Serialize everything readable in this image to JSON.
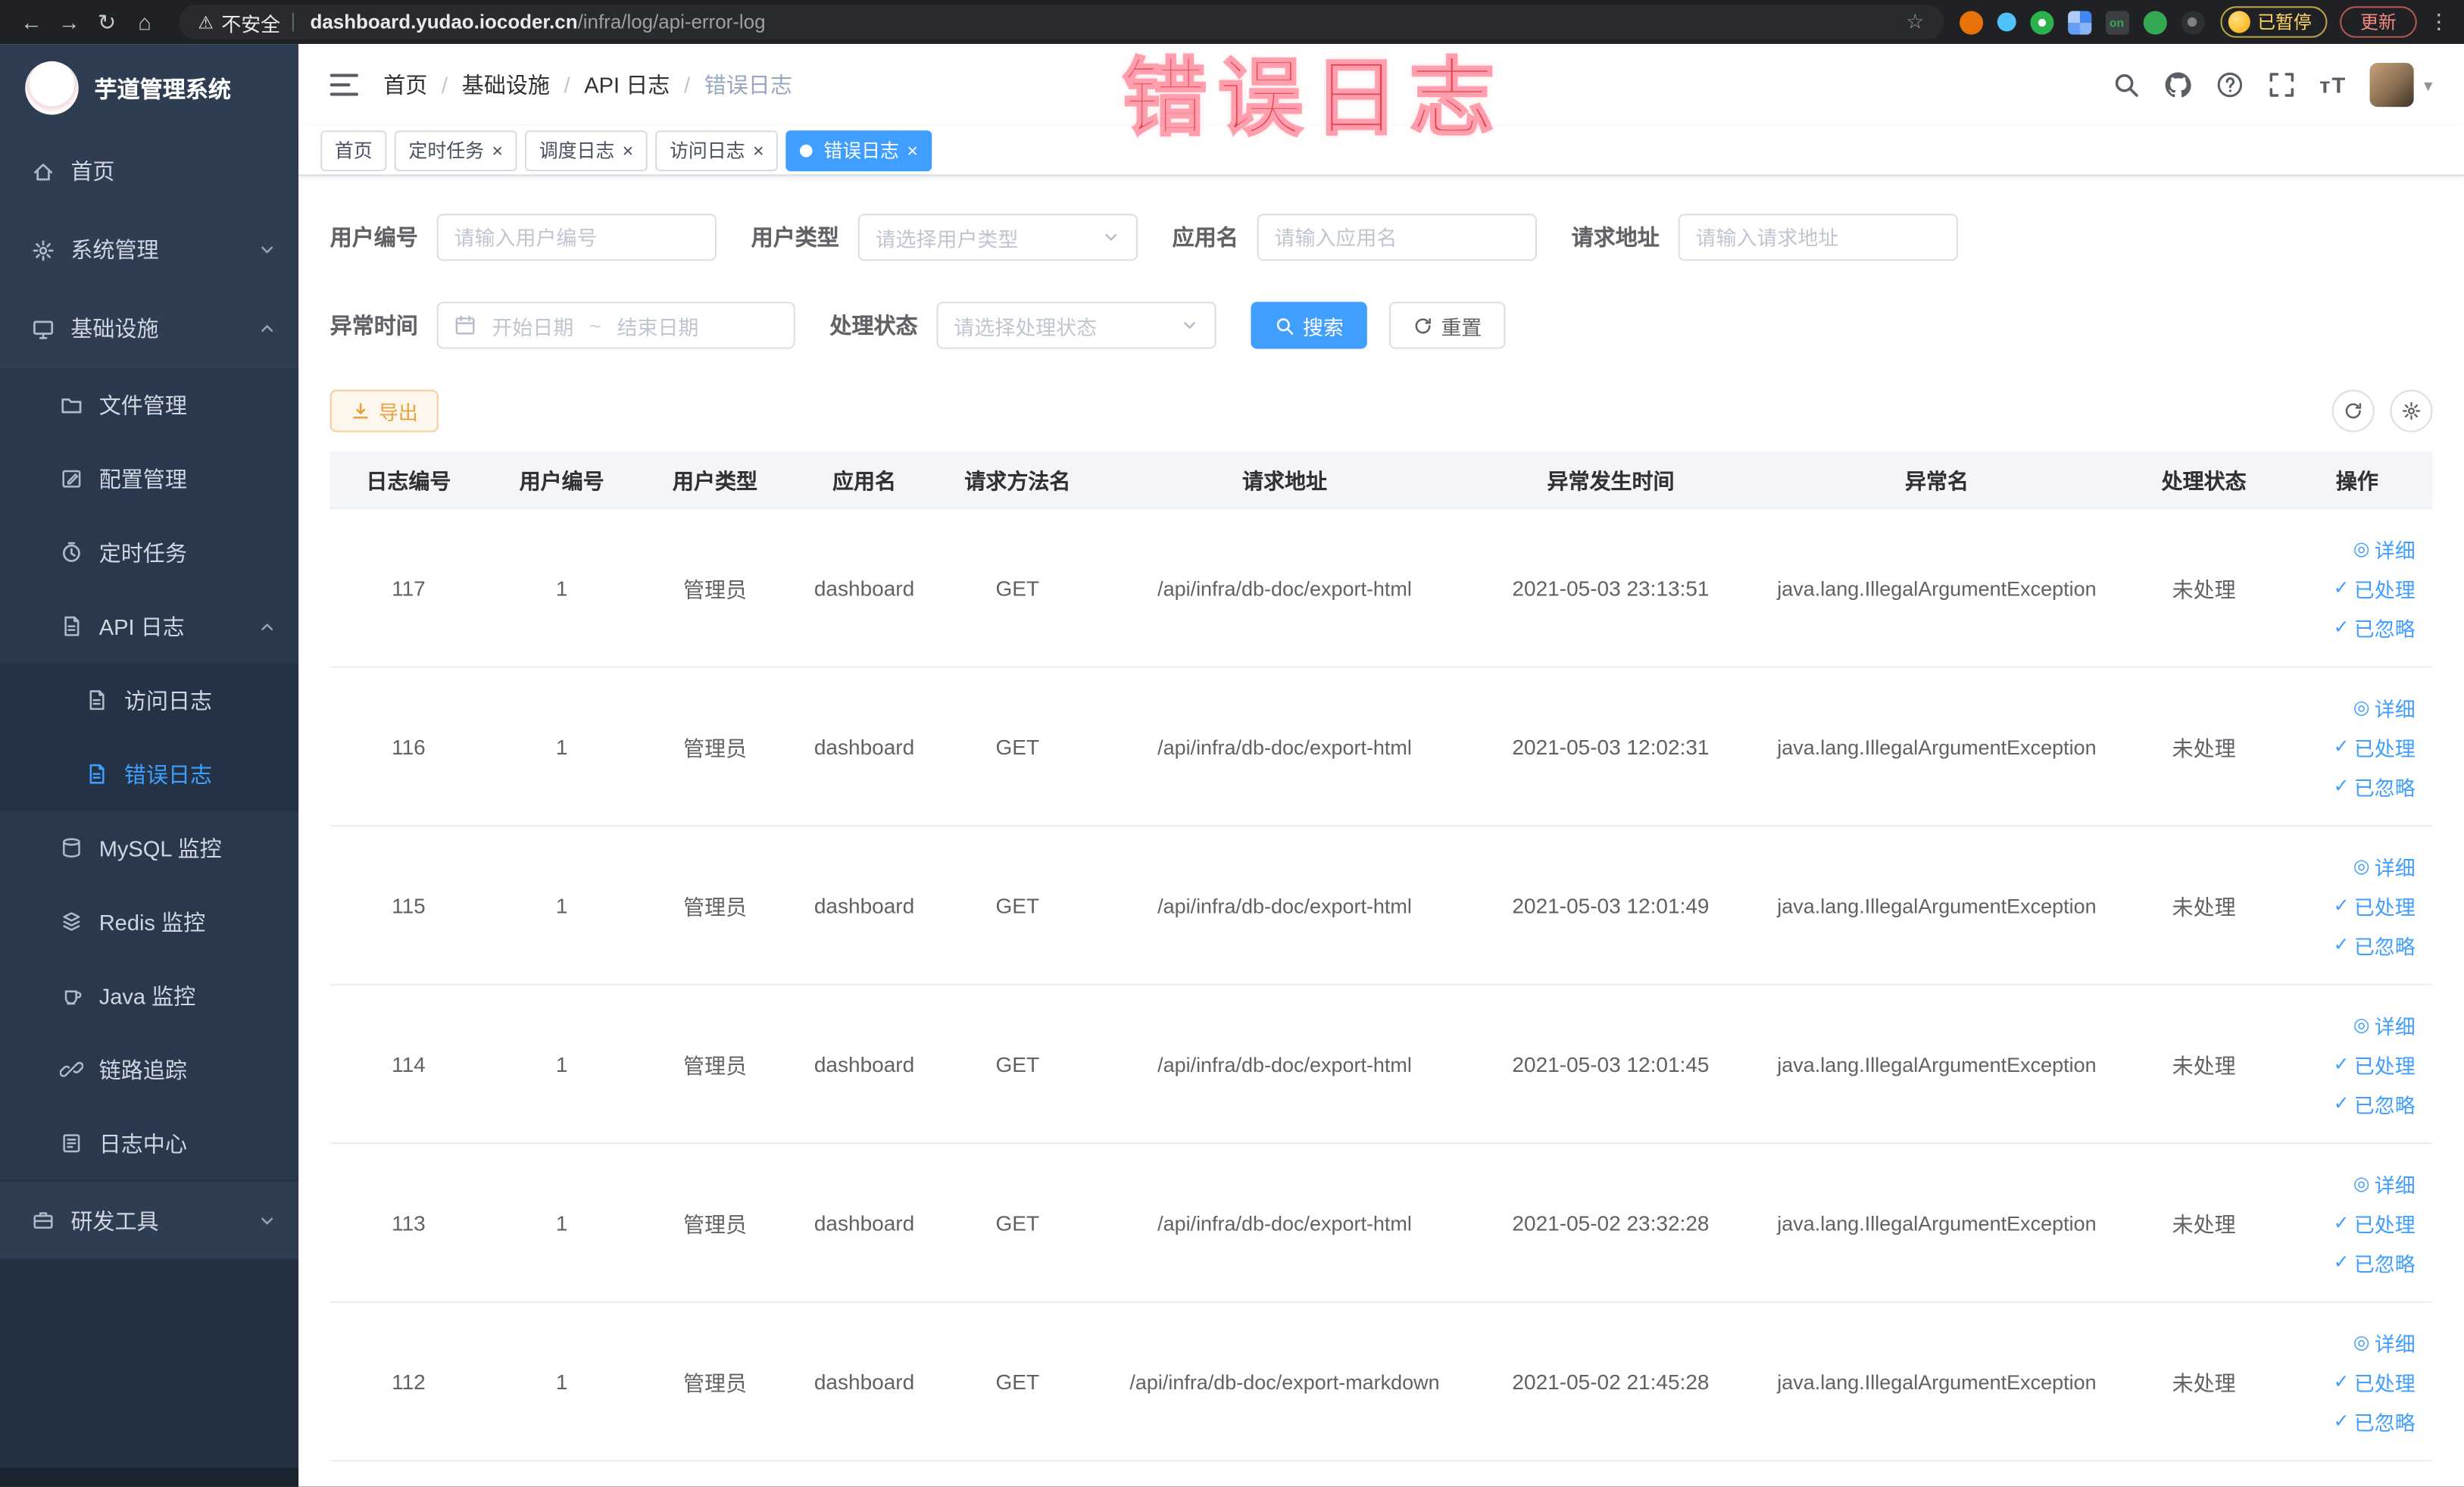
{
  "browser": {
    "security_chip": "不安全",
    "url_domain": "dashboard.yudao.iocoder.cn",
    "url_path": "/infra/log/api-error-log",
    "paused_badge": "已暂停",
    "update_button": "更新",
    "extension_badge_on": "on"
  },
  "glyphs": {
    "back": "←",
    "forward": "→",
    "reload": "↻",
    "home": "⌂",
    "warning": "⚠",
    "star": "☆",
    "menu_dots": "⋮",
    "close": "×",
    "caret_down": "▾",
    "font_size": "тT",
    "eye": "◎",
    "check": "✓"
  },
  "overlay_title": "错误日志",
  "sidebar": {
    "logo_title": "芋道管理系统",
    "menu": [
      {
        "label": "首页"
      },
      {
        "label": "系统管理"
      },
      {
        "label": "基础设施",
        "children": [
          {
            "label": "文件管理"
          },
          {
            "label": "配置管理"
          },
          {
            "label": "定时任务"
          },
          {
            "label": "API 日志",
            "children": [
              {
                "label": "访问日志"
              },
              {
                "label": "错误日志"
              }
            ]
          },
          {
            "label": "MySQL 监控"
          },
          {
            "label": "Redis 监控"
          },
          {
            "label": "Java 监控"
          },
          {
            "label": "链路追踪"
          },
          {
            "label": "日志中心"
          }
        ]
      },
      {
        "label": "研发工具"
      }
    ]
  },
  "header": {
    "breadcrumb": [
      "首页",
      "基础设施",
      "API 日志",
      "错误日志"
    ],
    "breadcrumb_separator": "/"
  },
  "tabs": [
    {
      "label": "首页"
    },
    {
      "label": "定时任务"
    },
    {
      "label": "调度日志"
    },
    {
      "label": "访问日志"
    },
    {
      "label": "错误日志"
    }
  ],
  "filters": {
    "user_id": {
      "label": "用户编号",
      "placeholder": "请输入用户编号"
    },
    "user_type": {
      "label": "用户类型",
      "placeholder": "请选择用户类型"
    },
    "app_name": {
      "label": "应用名",
      "placeholder": "请输入应用名"
    },
    "request_url": {
      "label": "请求地址",
      "placeholder": "请输入请求地址"
    },
    "exception_time": {
      "label": "异常时间",
      "start_placeholder": "开始日期",
      "separator": "~",
      "end_placeholder": "结束日期"
    },
    "process_status": {
      "label": "处理状态",
      "placeholder": "请选择处理状态"
    },
    "search_button": "搜索",
    "reset_button": "重置"
  },
  "toolbar": {
    "export_button": "导出"
  },
  "table": {
    "columns": [
      "日志编号",
      "用户编号",
      "用户类型",
      "应用名",
      "请求方法名",
      "请求地址",
      "异常发生时间",
      "异常名",
      "处理状态",
      "操作"
    ],
    "actions": [
      "详细",
      "已处理",
      "已忽略"
    ],
    "rows": [
      {
        "id": "117",
        "user_id": "1",
        "user_type": "管理员",
        "app_name": "dashboard",
        "method": "GET",
        "url": "/api/infra/db-doc/export-html",
        "time": "2021-05-03 23:13:51",
        "exception": "java.lang.IllegalArgumentException",
        "status": "未处理"
      },
      {
        "id": "116",
        "user_id": "1",
        "user_type": "管理员",
        "app_name": "dashboard",
        "method": "GET",
        "url": "/api/infra/db-doc/export-html",
        "time": "2021-05-03 12:02:31",
        "exception": "java.lang.IllegalArgumentException",
        "status": "未处理"
      },
      {
        "id": "115",
        "user_id": "1",
        "user_type": "管理员",
        "app_name": "dashboard",
        "method": "GET",
        "url": "/api/infra/db-doc/export-html",
        "time": "2021-05-03 12:01:49",
        "exception": "java.lang.IllegalArgumentException",
        "status": "未处理"
      },
      {
        "id": "114",
        "user_id": "1",
        "user_type": "管理员",
        "app_name": "dashboard",
        "method": "GET",
        "url": "/api/infra/db-doc/export-html",
        "time": "2021-05-03 12:01:45",
        "exception": "java.lang.IllegalArgumentException",
        "status": "未处理"
      },
      {
        "id": "113",
        "user_id": "1",
        "user_type": "管理员",
        "app_name": "dashboard",
        "method": "GET",
        "url": "/api/infra/db-doc/export-html",
        "time": "2021-05-02 23:32:28",
        "exception": "java.lang.IllegalArgumentException",
        "status": "未处理"
      },
      {
        "id": "112",
        "user_id": "1",
        "user_type": "管理员",
        "app_name": "dashboard",
        "method": "GET",
        "url": "/api/infra/db-doc/export-markdown",
        "time": "2021-05-02 21:45:28",
        "exception": "java.lang.IllegalArgumentException",
        "status": "未处理"
      }
    ]
  },
  "colors": {
    "primary": "#409eff",
    "warning": "#e6a23c",
    "annotation": "#e8404f",
    "sidebar_bg": "#2f3d52"
  }
}
